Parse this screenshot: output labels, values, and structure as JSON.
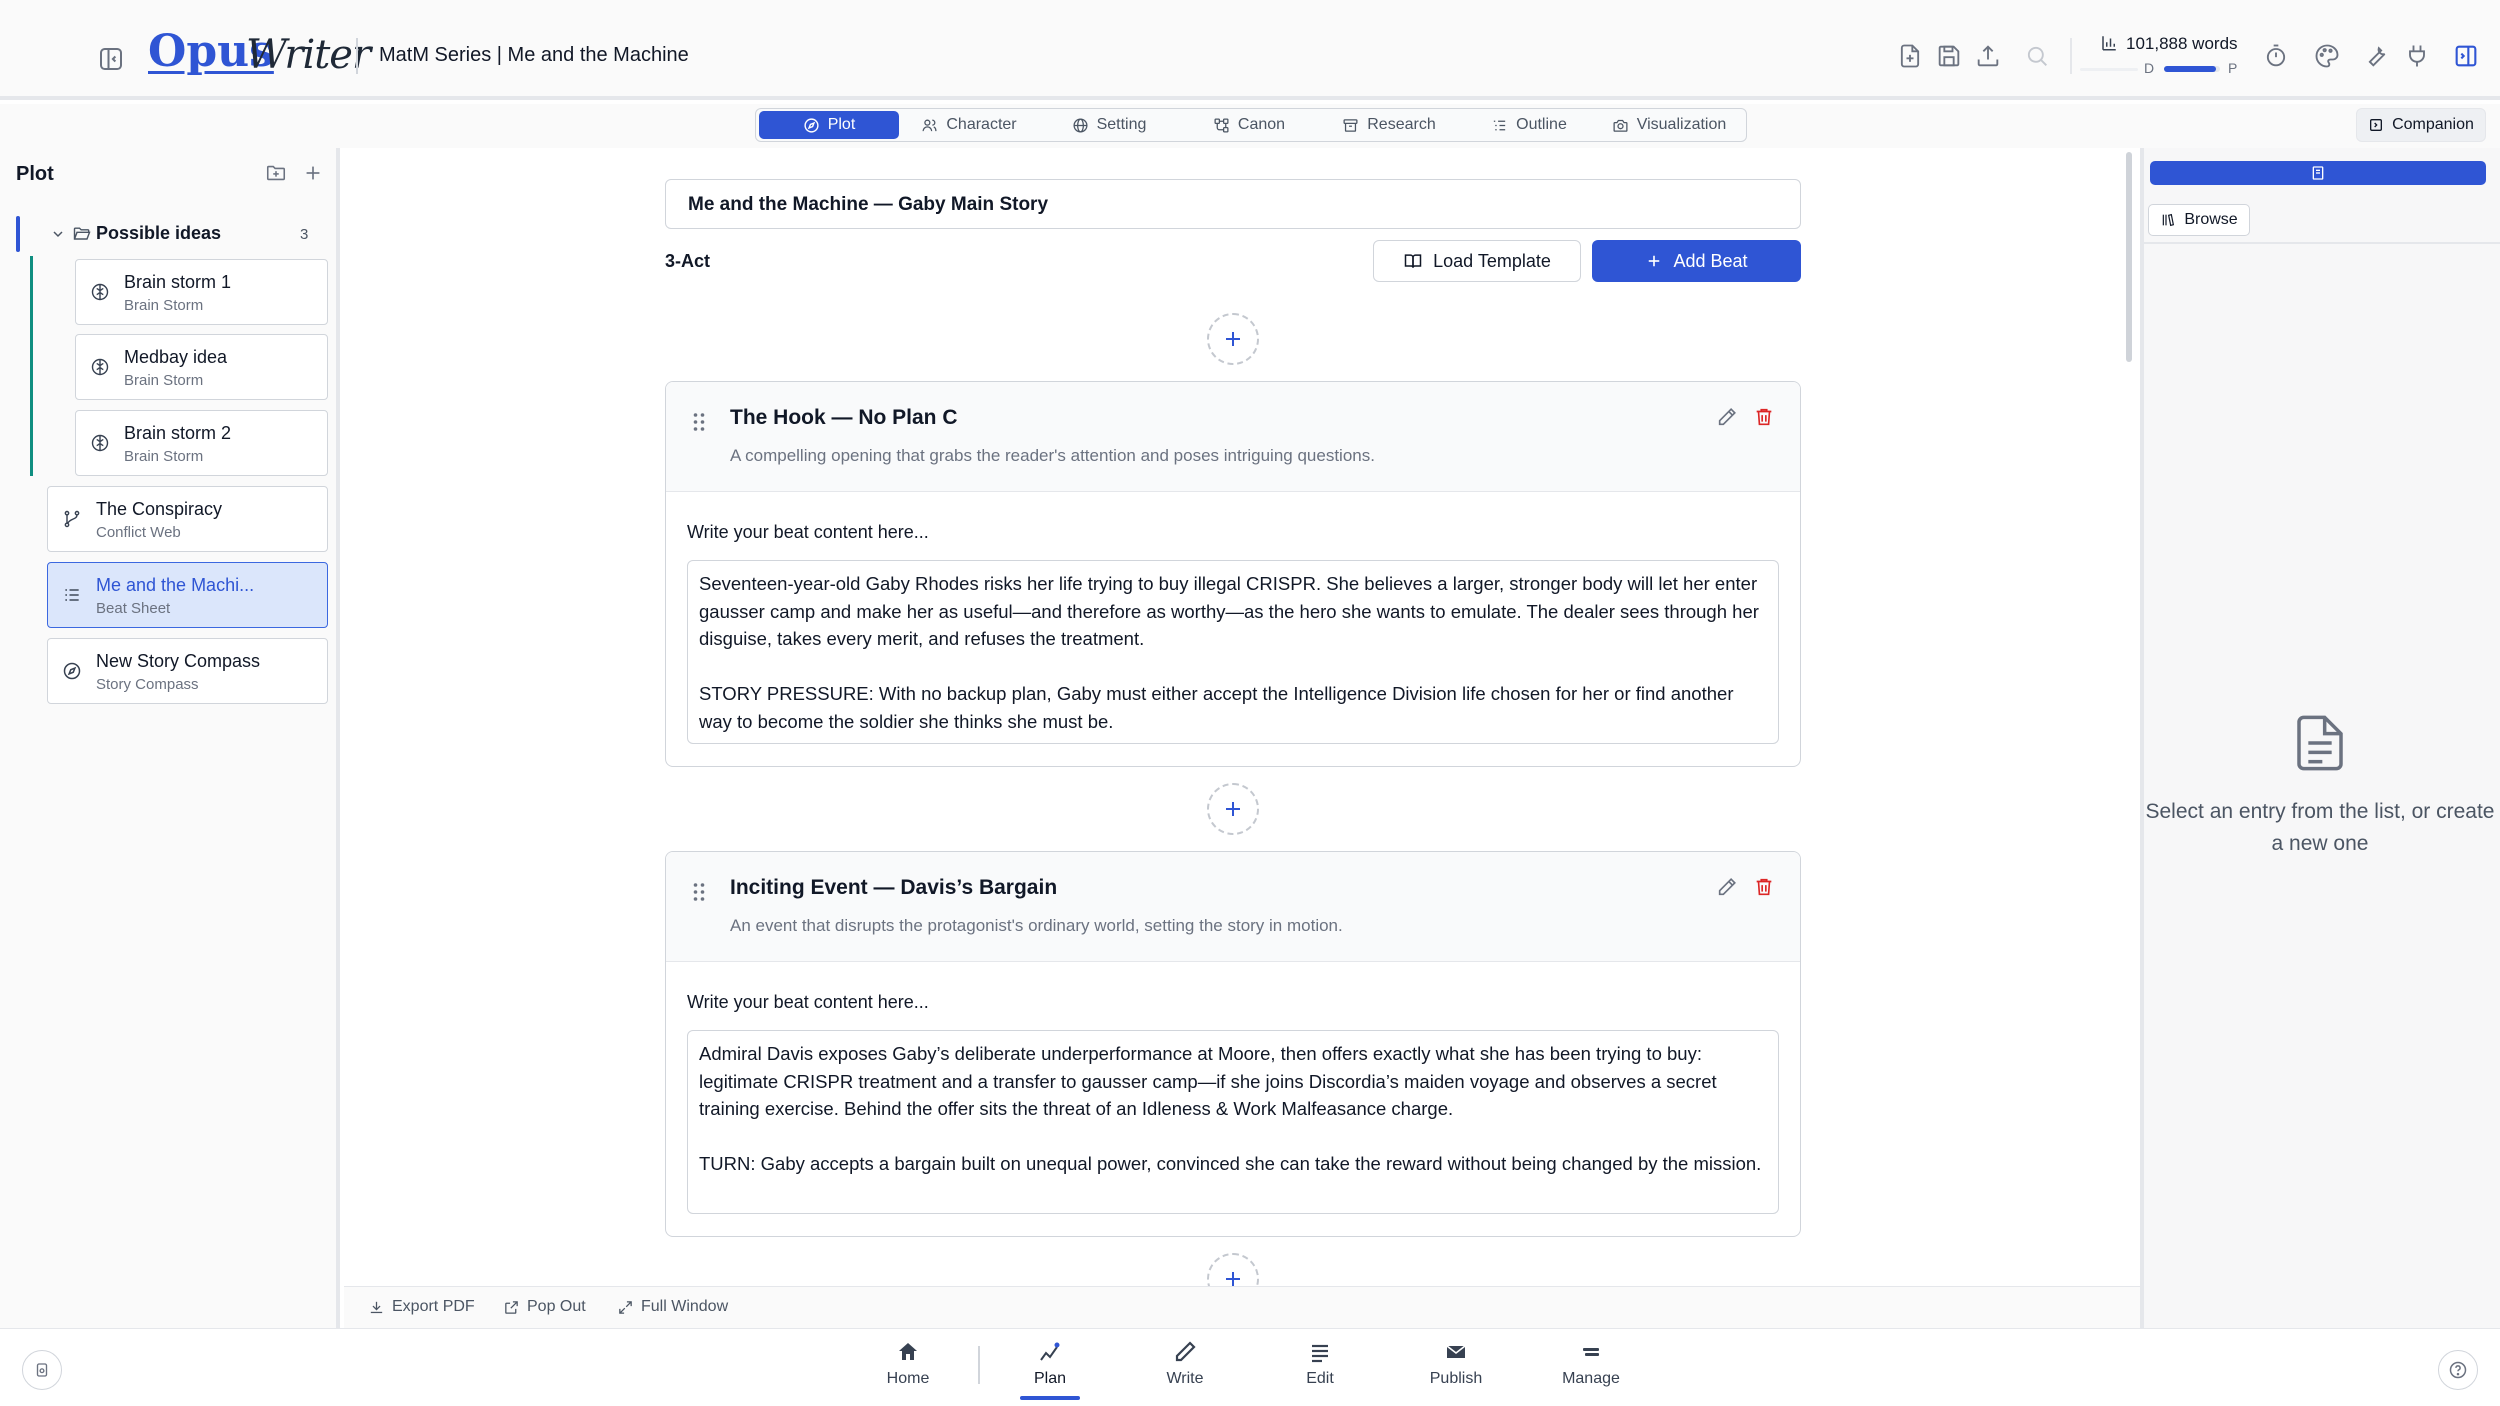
{
  "app": {
    "logo_primary": "Opus",
    "logo_secondary": "Writer",
    "document_title": "MatM Series | Me and the Machine"
  },
  "toolbar": {
    "word_count": "101,888 words",
    "draft_label": "D",
    "publish_label": "P",
    "draft_progress": 0.93,
    "icons": [
      "new-file-icon",
      "save-icon",
      "export-icon",
      "search-icon",
      "timer-icon",
      "palette-icon",
      "wrench-icon",
      "plug-icon",
      "panel-right-icon"
    ]
  },
  "tabs": [
    {
      "label": "Plot",
      "icon": "compass-icon",
      "active": true
    },
    {
      "label": "Character",
      "icon": "users-icon",
      "active": false
    },
    {
      "label": "Setting",
      "icon": "globe-icon",
      "active": false
    },
    {
      "label": "Canon",
      "icon": "network-icon",
      "active": false
    },
    {
      "label": "Research",
      "icon": "archive-icon",
      "active": false
    },
    {
      "label": "Outline",
      "icon": "list-icon",
      "active": false
    },
    {
      "label": "Visualization",
      "icon": "camera-icon",
      "active": false
    }
  ],
  "companion": {
    "label": "Companion"
  },
  "sidebar": {
    "heading": "Plot",
    "folder": {
      "label": "Possible ideas",
      "count": "3"
    },
    "folder_items": [
      {
        "title": "Brain storm 1",
        "subtitle": "Brain Storm",
        "icon": "brain-icon"
      },
      {
        "title": "Medbay idea",
        "subtitle": "Brain Storm",
        "icon": "brain-icon"
      },
      {
        "title": "Brain storm 2",
        "subtitle": "Brain Storm",
        "icon": "brain-icon"
      }
    ],
    "items": [
      {
        "title": "The Conspiracy",
        "subtitle": "Conflict Web",
        "icon": "git-branch-icon",
        "selected": false
      },
      {
        "title": "Me and the Machi...",
        "subtitle": "Beat Sheet",
        "icon": "list-icon",
        "selected": true
      },
      {
        "title": "New Story Compass",
        "subtitle": "Story Compass",
        "icon": "compass-icon",
        "selected": false
      }
    ]
  },
  "main": {
    "story_title": "Me and the Machine — Gaby Main Story",
    "structure": "3-Act",
    "load_template_label": "Load Template",
    "add_beat_label": "Add Beat",
    "content_label": "Write your beat content here...",
    "beats": [
      {
        "title": "The Hook — No Plan C",
        "description": "A compelling opening that grabs the reader's attention and poses intriguing questions.",
        "paragraphs": [
          "Seventeen-year-old Gaby Rhodes risks her life trying to buy illegal CRISPR. She believes a larger, stronger body will let her enter gausser camp and make her as useful—and therefore as worthy—as the hero she wants to emulate. The dealer sees through her disguise, takes every merit, and refuses the treatment.",
          "STORY PRESSURE: With no backup plan, Gaby must either accept the Intelligence Division life chosen for her or find another way to become the soldier she thinks she must be."
        ]
      },
      {
        "title": "Inciting Event — Davis’s Bargain",
        "description": "An event that disrupts the protagonist's ordinary world, setting the story in motion.",
        "paragraphs": [
          "Admiral Davis exposes Gaby’s deliberate underperformance at Moore, then offers exactly what she has been trying to buy: legitimate CRISPR treatment and a transfer to gausser camp—if she joins Discordia’s maiden voyage and observes a secret training exercise. Behind the offer sits the threat of an Idleness & Work Malfeasance charge.",
          "TURN: Gaby accepts a bargain built on unequal power, convinced she can take the reward without being changed by the mission."
        ]
      }
    ],
    "actions": {
      "export_pdf": "Export PDF",
      "pop_out": "Pop Out",
      "full_window": "Full Window"
    }
  },
  "right_panel": {
    "browse_label": "Browse",
    "empty_text": "Select an entry from the list, or create a new one"
  },
  "bottom_nav": [
    {
      "label": "Home",
      "icon": "home-icon",
      "active": false
    },
    {
      "label": "Plan",
      "icon": "plan-icon",
      "active": true
    },
    {
      "label": "Write",
      "icon": "pen-icon",
      "active": false
    },
    {
      "label": "Edit",
      "icon": "edit-lines-icon",
      "active": false
    },
    {
      "label": "Publish",
      "icon": "mail-icon",
      "active": false
    },
    {
      "label": "Manage",
      "icon": "manage-icon",
      "active": false
    }
  ],
  "colors": {
    "accent": "#2f55d4",
    "folder_line": "#0f8e80",
    "danger": "#dc2626",
    "selected_bg": "#dbe6fb"
  }
}
